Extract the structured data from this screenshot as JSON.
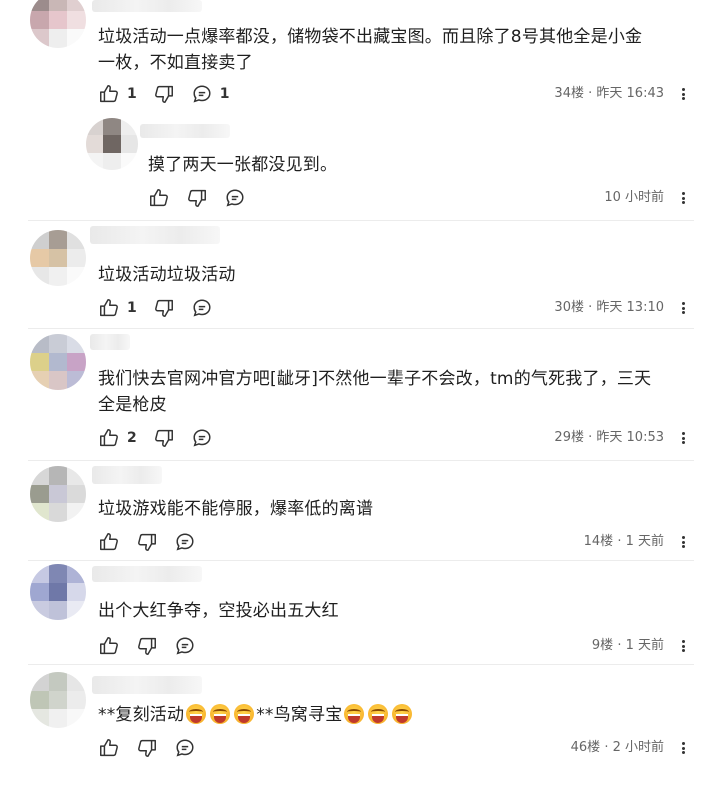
{
  "comments": [
    {
      "text_lines": [
        "垃圾活动一点爆率都没，储物袋不出藏宝图。而且除了8号其他全是小金",
        "一枚，不如直接卖了"
      ],
      "like_count": "1",
      "dislike_count": "",
      "reply_count": "1",
      "floor": "34楼",
      "sep": "·",
      "time": "昨天 16:43",
      "avatar_colors": [
        "#9c8c8c",
        "#c9b7b6",
        "#e0cfd0",
        "#c8a7ad",
        "#e6c6cc",
        "#f0dfe1",
        "#dcc8cb",
        "#eee",
        "#fafafa"
      ]
    },
    {
      "text_lines": [
        "摸了两天一张都没见到。"
      ],
      "like_count": "",
      "dislike_count": "",
      "reply_count": "",
      "floor": "",
      "sep": "",
      "time": "10 小时前",
      "avatar_colors": [
        "#d8d2d0",
        "#8f8783",
        "#eee",
        "#e3dbd8",
        "#6f6662",
        "#e6e6e6",
        "#f4f4f4",
        "#eee",
        "#fafafa"
      ]
    },
    {
      "text_lines": [
        "垃圾活动垃圾活动"
      ],
      "like_count": "1",
      "dislike_count": "",
      "reply_count": "",
      "floor": "30楼",
      "sep": "·",
      "time": "昨天 13:10",
      "avatar_colors": [
        "#cfcfcf",
        "#a79d94",
        "#e0e0e0",
        "#e6c9a6",
        "#d6c2a5",
        "#ececec",
        "#e7e7e7",
        "#f0f0f0",
        "#fafafa"
      ]
    },
    {
      "text_lines": [
        "我们快去官网冲官方吧[龇牙]不然他一辈子不会改，tm的气死我了，三天",
        "全是枪皮"
      ],
      "like_count": "2",
      "dislike_count": "",
      "reply_count": "",
      "floor": "29楼",
      "sep": "·",
      "time": "昨天 10:53",
      "avatar_colors": [
        "#b8bcc7",
        "#c9ccd6",
        "#d9dce6",
        "#dcd08a",
        "#b2b9cf",
        "#c8a3c6",
        "#e6d0b3",
        "#d9c6c6",
        "#bcbcd6"
      ]
    },
    {
      "text_lines": [
        "垃圾游戏能不能停服，爆率低的离谱"
      ],
      "like_count": "",
      "dislike_count": "",
      "reply_count": "",
      "floor": "14楼",
      "sep": "·",
      "time": "1 天前",
      "avatar_colors": [
        "#d7d7d7",
        "#b6b6b6",
        "#e8e8e8",
        "#9a9c8f",
        "#c9c8d6",
        "#dadada",
        "#e0e6ce",
        "#d9d9d9",
        "#f2f2f2"
      ]
    },
    {
      "text_lines": [
        "出个大红争夺，空投必出五大红"
      ],
      "like_count": "",
      "dislike_count": "",
      "reply_count": "",
      "floor": "9楼",
      "sep": "·",
      "time": "1 天前",
      "avatar_colors": [
        "#c6c9e3",
        "#7f87b3",
        "#aeb3d6",
        "#9fa7d1",
        "#6f78a8",
        "#d6d8ea",
        "#c9cbe0",
        "#bfc2d9",
        "#e9eaf3"
      ]
    },
    {
      "text_lines_rich": [
        "**复刻活动",
        "emoji",
        "emoji",
        "emoji",
        "**鸟窝寻宝",
        "emoji",
        "emoji",
        "emoji"
      ],
      "like_count": "",
      "dislike_count": "",
      "reply_count": "",
      "floor": "46楼",
      "sep": "·",
      "time": "2 小时前",
      "avatar_colors": [
        "#d3d3d3",
        "#c4c9c0",
        "#e6e6e6",
        "#bfc6b6",
        "#d0d4cc",
        "#ececec",
        "#e5e7e1",
        "#f0f0f0",
        "#f8f8f8"
      ]
    }
  ],
  "icons": {
    "like": "thumbs-up-icon",
    "dislike": "thumbs-down-icon",
    "reply": "reply-bubble-icon",
    "more": "more-vertical-icon",
    "emoji": "grin-emoji-icon"
  }
}
